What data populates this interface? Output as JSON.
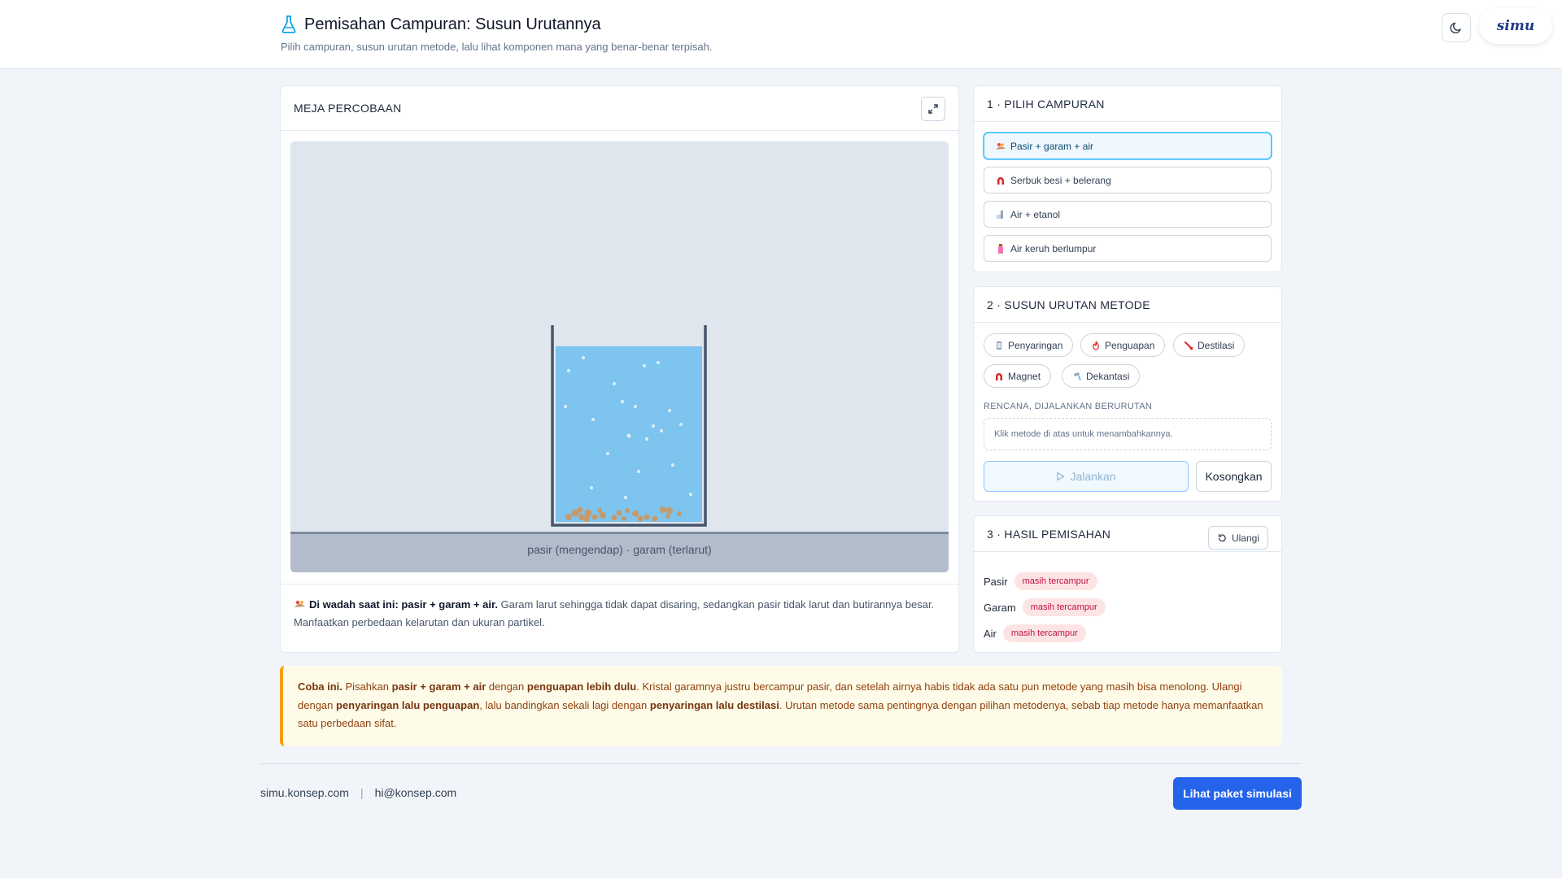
{
  "app": {
    "title": "Pemisahan Campuran: Susun Urutannya",
    "subtitle": "Pilih campuran, susun urutan metode, lalu lihat komponen mana yang benar-benar terpisah.",
    "logo_text": "simu",
    "flask_icon": "flask-icon",
    "theme_icon": "moon-icon"
  },
  "bench": {
    "header": "MEJA PERCOBAAN",
    "expand_icon": "expand-icon",
    "floor_label": "pasir (mengendap) · garam (terlarut)",
    "desc_bold": "Di wadah saat ini: pasir + garam + air.",
    "desc_text": "Garam larut sehingga tidak dapat disaring, sedangkan pasir tidak larut dan butirannya besar. Manfaatkan perbedaan kelarutan dan ukuran partikel."
  },
  "mixtures": {
    "header": "1 · PILIH CAMPURAN",
    "items": [
      {
        "label": "Pasir + garam + air",
        "icon": "sand-salt-icon",
        "selected": true
      },
      {
        "label": "Serbuk besi + belerang",
        "icon": "magnet-icon",
        "selected": false
      },
      {
        "label": "Air + etanol",
        "icon": "bottle-icon",
        "selected": false
      },
      {
        "label": "Air keruh berlumpur",
        "icon": "muddy-water-icon",
        "selected": false
      }
    ]
  },
  "methods": {
    "header": "2 · SUSUN URUTAN METODE",
    "chips": [
      {
        "label": "Penyaringan",
        "icon": "filter-icon"
      },
      {
        "label": "Penguapan",
        "icon": "flame-icon"
      },
      {
        "label": "Destilasi",
        "icon": "thermometer-icon"
      },
      {
        "label": "Magnet",
        "icon": "magnet-icon"
      },
      {
        "label": "Dekantasi",
        "icon": "pour-icon"
      }
    ],
    "plan_label": "RENCANA, DIJALANKAN BERURUTAN",
    "plan_placeholder": "Klik metode di atas untuk menambahkannya.",
    "run_label": "Jalankan",
    "clear_label": "Kosongkan"
  },
  "results": {
    "header": "3 · HASIL PEMISAHAN",
    "reset_label": "Ulangi",
    "rows": [
      {
        "name": "Pasir",
        "status": "masih tercampur"
      },
      {
        "name": "Garam",
        "status": "masih tercampur"
      },
      {
        "name": "Air",
        "status": "masih tercampur"
      }
    ]
  },
  "tip": {
    "lead": "Coba ini.",
    "t1": "Pisahkan",
    "b1": "pasir + garam + air",
    "t2": "dengan",
    "b2": "penguapan lebih dulu",
    "t3": ". Kristal garamnya justru bercampur pasir, dan setelah airnya habis tidak ada satu pun metode yang masih bisa menolong. Ulangi dengan",
    "b3": "penyaringan lalu penguapan",
    "t4": ", lalu bandingkan sekali lagi dengan",
    "b4": "penyaringan lalu destilasi",
    "t5": ". Urutan metode sama pentingnya dengan pilihan metodenya, sebab tiap metode hanya memanfaatkan satu perbedaan sifat."
  },
  "footer": {
    "site": "simu.konsep.com",
    "separator": "|",
    "email": "hi@konsep.com",
    "cta": "Lihat paket simulasi"
  },
  "colors": {
    "accent": "#2563eb",
    "water": "#7dc4ee",
    "sand": "#c49a6c",
    "badge_bg": "#fde4e4",
    "badge_text": "#be123c",
    "tip_border": "#f59e0b"
  }
}
